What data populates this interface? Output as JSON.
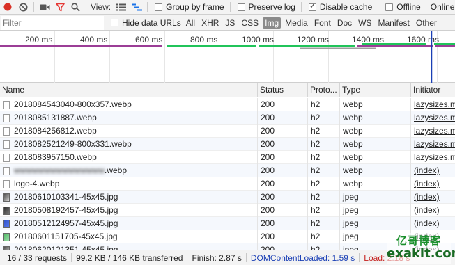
{
  "toolbar": {
    "view_label": "View:",
    "group_by_frame": "Group by frame",
    "preserve_log": "Preserve log",
    "disable_cache": "Disable cache",
    "offline": "Offline",
    "online": "Online"
  },
  "filterbar": {
    "filter_placeholder": "Filter",
    "hide_data_urls": "Hide data URLs",
    "types": [
      "All",
      "XHR",
      "JS",
      "CSS",
      "Img",
      "Media",
      "Font",
      "Doc",
      "WS",
      "Manifest",
      "Other"
    ],
    "active_type": "Img"
  },
  "overview": {
    "ticks": [
      "200 ms",
      "400 ms",
      "600 ms",
      "800 ms",
      "1000 ms",
      "1200 ms",
      "1400 ms",
      "1600 ms"
    ]
  },
  "columns": [
    "Name",
    "Status",
    "Protocol",
    "Type",
    "Initiator"
  ],
  "column_labels": {
    "name": "Name",
    "status": "Status",
    "protocol": "Proto...",
    "type": "Type",
    "initiator": "Initiator"
  },
  "rows": [
    {
      "name": "2018084543040-800x357.webp",
      "status": "200",
      "protocol": "h2",
      "type": "webp",
      "initiator": "lazysizes.mi",
      "icon": "doc"
    },
    {
      "name": "2018085131887.webp",
      "status": "200",
      "protocol": "h2",
      "type": "webp",
      "initiator": "lazysizes.mi",
      "icon": "doc"
    },
    {
      "name": "2018084256812.webp",
      "status": "200",
      "protocol": "h2",
      "type": "webp",
      "initiator": "lazysizes.mi",
      "icon": "doc"
    },
    {
      "name": "2018082521249-800x331.webp",
      "status": "200",
      "protocol": "h2",
      "type": "webp",
      "initiator": "lazysizes.mi",
      "icon": "doc"
    },
    {
      "name": "2018083957150.webp",
      "status": "200",
      "protocol": "h2",
      "type": "webp",
      "initiator": "lazysizes.mi",
      "icon": "doc"
    },
    {
      "name": ".webp",
      "status": "200",
      "protocol": "h2",
      "type": "webp",
      "initiator": "(index)",
      "icon": "doc",
      "blurred_prefix": "wwwwwwwwwwwwwww"
    },
    {
      "name": "logo-4.webp",
      "status": "200",
      "protocol": "h2",
      "type": "webp",
      "initiator": "(index)",
      "icon": "doc"
    },
    {
      "name": "20180610103341-45x45.jpg",
      "status": "200",
      "protocol": "h2",
      "type": "jpeg",
      "initiator": "(index)",
      "icon": "img"
    },
    {
      "name": "20180508192457-45x45.jpg",
      "status": "200",
      "protocol": "h2",
      "type": "jpeg",
      "initiator": "(index)",
      "icon": "img-dark"
    },
    {
      "name": "20180512124957-45x45.jpg",
      "status": "200",
      "protocol": "h2",
      "type": "jpeg",
      "initiator": "(index)",
      "icon": "img-blue"
    },
    {
      "name": "20180601151705-45x45.jpg",
      "status": "200",
      "protocol": "h2",
      "type": "jpeg",
      "initiator": "(index)",
      "icon": "img-green"
    },
    {
      "name": "20180620121351-45x45.jpg",
      "status": "200",
      "protocol": "h2",
      "type": "jpeg",
      "initiator": "(index)",
      "icon": "img"
    }
  ],
  "statusbar": {
    "requests": "16 / 33 requests",
    "transferred": "99.2 KB / 146 KB transferred",
    "finish": "Finish: 2.87 s",
    "dom_content_loaded": "DOMContentLoaded: 1.59 s",
    "load": "Load: 2.18 s"
  },
  "watermark": {
    "line1": "亿哥博客",
    "line2": "exakit.com"
  },
  "colors": {
    "record_red": "#d93025",
    "filter_red": "#e53935",
    "active_type_bg": "#8a8a8a",
    "dcl_blue": "#1a3fb5",
    "load_red": "#c5221f",
    "timeline_purple": "#9b3d96",
    "timeline_green": "#21c45a"
  }
}
